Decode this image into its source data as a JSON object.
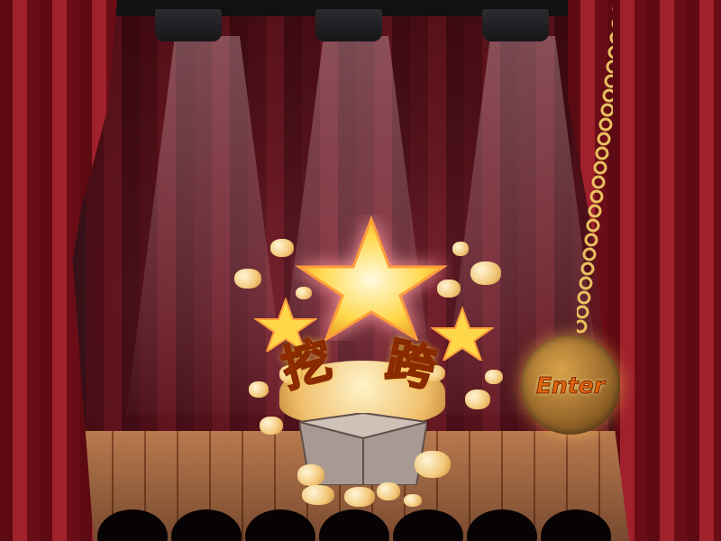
{
  "scene": {
    "title_chars": [
      "挖",
      "跨"
    ],
    "enter_label": "Enter"
  },
  "colors": {
    "title_orange": "#e2640f",
    "star_gold": "#ffd84a",
    "curtain_red": "#a0202c"
  },
  "icons": {
    "spotlight": "spotlight-icon",
    "star": "star-icon",
    "popcorn": "popcorn-icon",
    "chain": "chain-icon"
  }
}
